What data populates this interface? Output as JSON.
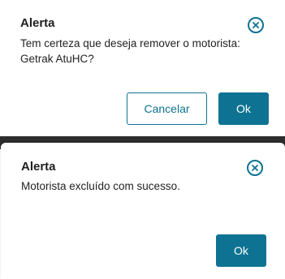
{
  "dialog_confirm": {
    "title": "Alerta",
    "message_line1": "Tem certeza que deseja remover o motorista:",
    "message_line2": "Getrak AtuHC?",
    "cancel_label": "Cancelar",
    "ok_label": "Ok",
    "close_icon": "close-circle-icon"
  },
  "dialog_success": {
    "title": "Alerta",
    "message": "Motorista excluído com sucesso.",
    "ok_label": "Ok",
    "close_icon": "close-circle-icon"
  },
  "colors": {
    "accent": "#0e7392",
    "text": "#1e1e1e",
    "overlay": "#2d2d2d"
  }
}
